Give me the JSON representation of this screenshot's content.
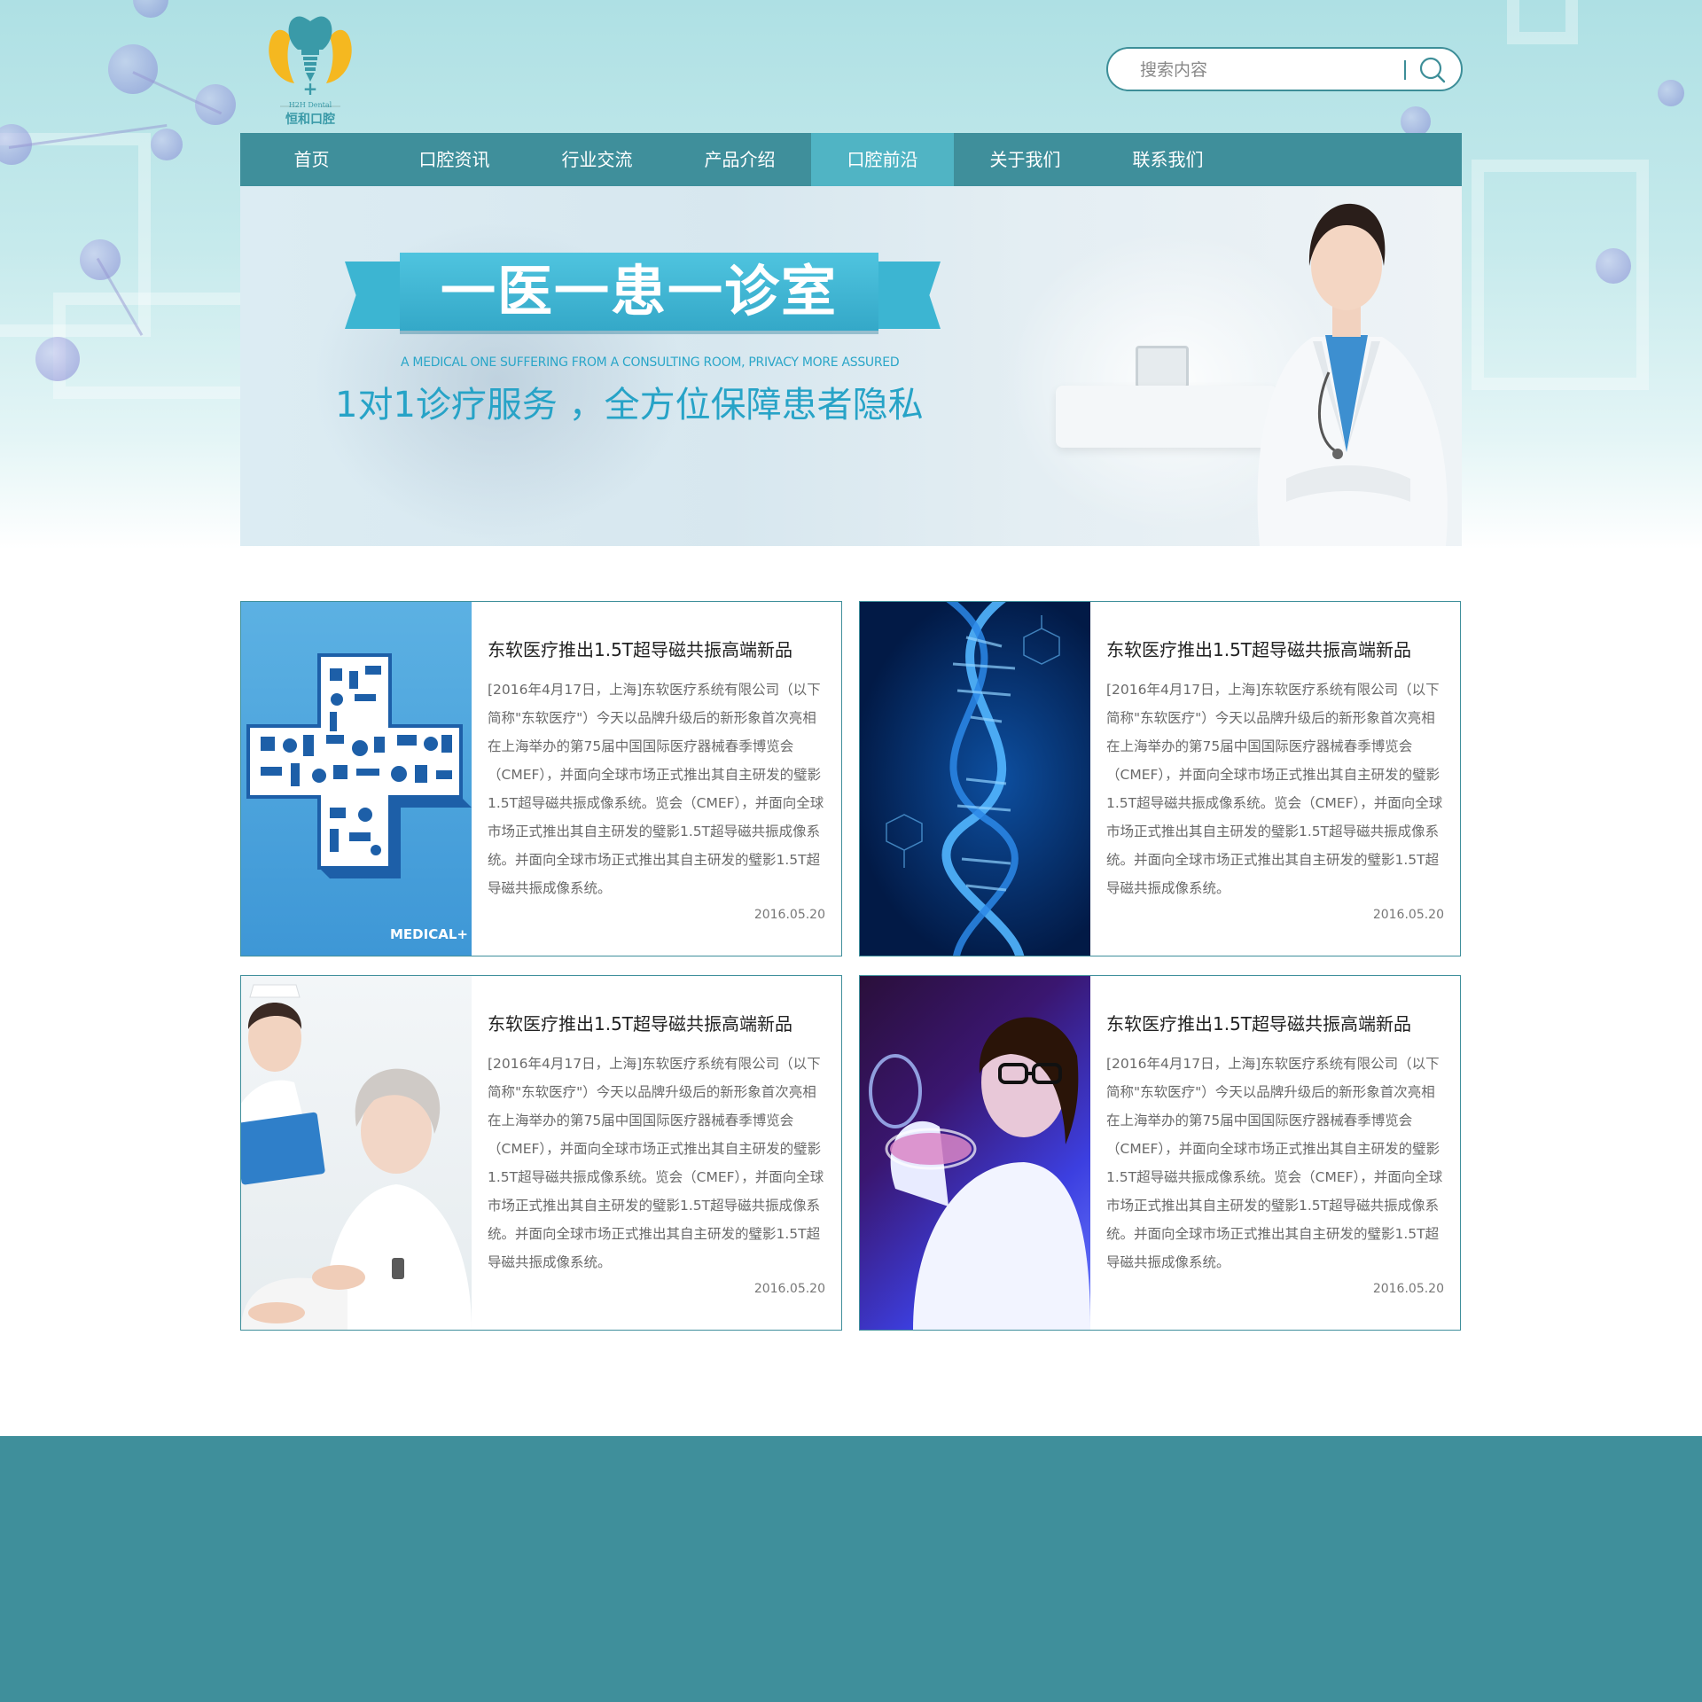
{
  "brand": {
    "logo_cn": "恒和口腔",
    "logo_en": "H2H Dental",
    "logo_plus": "+"
  },
  "search": {
    "placeholder": "搜索内容"
  },
  "nav": {
    "items": [
      {
        "label": "首页"
      },
      {
        "label": "口腔资讯"
      },
      {
        "label": "行业交流"
      },
      {
        "label": "产品介绍"
      },
      {
        "label": "口腔前沿"
      },
      {
        "label": "关于我们"
      },
      {
        "label": "联系我们"
      }
    ],
    "active_index": 4
  },
  "banner": {
    "title": "一医一患一诊室",
    "english": "A MEDICAL ONE SUFFERING FROM A CONSULTING ROOM, PRIVACY MORE ASSURED",
    "subtitle": "1对1诊疗服务 ，全方位保障患者隐私"
  },
  "articles": [
    {
      "title": "东软医疗推出1.5T超导磁共振高端新品",
      "body": "[2016年4月17日，上海]东软医疗系统有限公司（以下简称\"东软医疗\"）今天以品牌升级后的新形象首次亮相在上海举办的第75届中国国际医疗器械春季博览会（CMEF），并面向全球市场正式推出其自主研发的璧影1.5T超导磁共振成像系统。览会（CMEF），并面向全球市场正式推出其自主研发的璧影1.5T超导磁共振成像系统。并面向全球市场正式推出其自主研发的璧影1.5T超导磁共振成像系统。",
      "date": "2016.05.20",
      "image": "medical-cross-image",
      "image_text": "MEDICAL+"
    },
    {
      "title": "东软医疗推出1.5T超导磁共振高端新品",
      "body": "[2016年4月17日，上海]东软医疗系统有限公司（以下简称\"东软医疗\"）今天以品牌升级后的新形象首次亮相在上海举办的第75届中国国际医疗器械春季博览会（CMEF），并面向全球市场正式推出其自主研发的璧影1.5T超导磁共振成像系统。览会（CMEF），并面向全球市场正式推出其自主研发的璧影1.5T超导磁共振成像系统。并面向全球市场正式推出其自主研发的璧影1.5T超导磁共振成像系统。",
      "date": "2016.05.20",
      "image": "dna-helix-image"
    },
    {
      "title": "东软医疗推出1.5T超导磁共振高端新品",
      "body": "[2016年4月17日，上海]东软医疗系统有限公司（以下简称\"东软医疗\"）今天以品牌升级后的新形象首次亮相在上海举办的第75届中国国际医疗器械春季博览会（CMEF），并面向全球市场正式推出其自主研发的璧影1.5T超导磁共振成像系统。览会（CMEF），并面向全球市场正式推出其自主研发的璧影1.5T超导磁共振成像系统。并面向全球市场正式推出其自主研发的璧影1.5T超导磁共振成像系统。",
      "date": "2016.05.20",
      "image": "nurse-patient-image"
    },
    {
      "title": "东软医疗推出1.5T超导磁共振高端新品",
      "body": "[2016年4月17日，上海]东软医疗系统有限公司（以下简称\"东软医疗\"）今天以品牌升级后的新形象首次亮相在上海举办的第75届中国国际医疗器械春季博览会（CMEF），并面向全球市场正式推出其自主研发的璧影1.5T超导磁共振成像系统。览会（CMEF），并面向全球市场正式推出其自主研发的璧影1.5T超导磁共振成像系统。并面向全球市场正式推出其自主研发的璧影1.5T超导磁共振成像系统。",
      "date": "2016.05.20",
      "image": "lab-scientist-image"
    }
  ],
  "colors": {
    "primary": "#3f8f9b",
    "nav_active": "#50b4c4",
    "banner_accent": "#3cb5d2",
    "logo_yellow": "#f5b820",
    "logo_teal": "#3a9aa8"
  },
  "icons": {
    "search": "search-icon",
    "logo": "tooth-implant-logo-icon"
  }
}
